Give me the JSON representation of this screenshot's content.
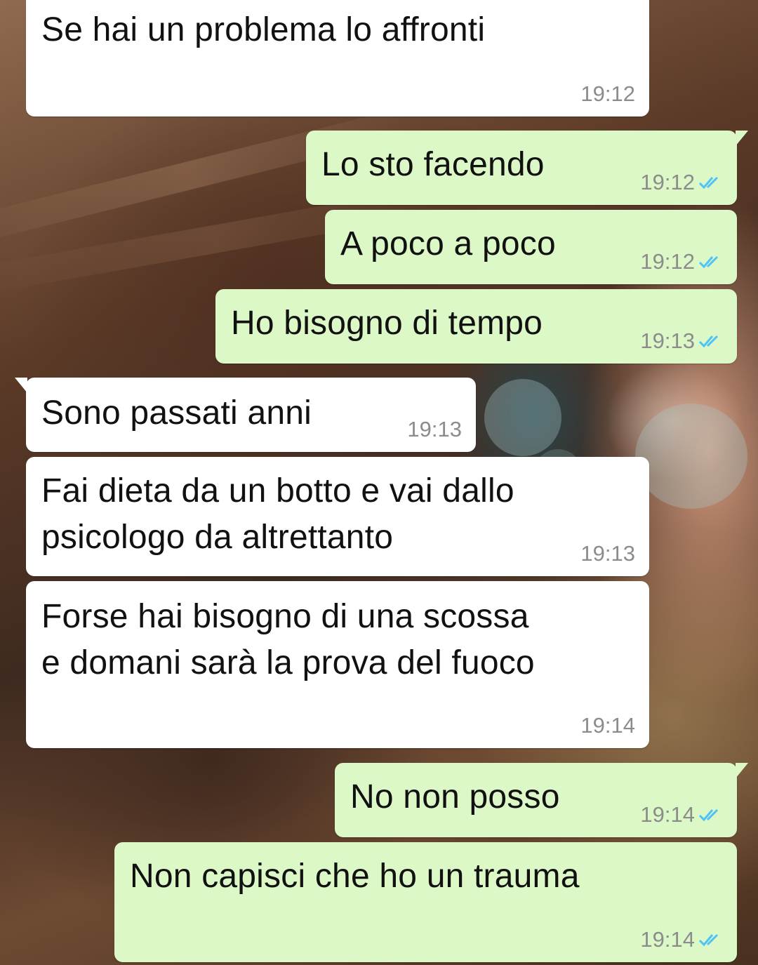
{
  "chat": {
    "messages": [
      {
        "direction": "incoming",
        "text": "Se hai un problema lo affronti",
        "time": "19:12"
      },
      {
        "direction": "outgoing",
        "text": "Lo sto facendo",
        "time": "19:12",
        "status": "read-double-tick-icon"
      },
      {
        "direction": "outgoing",
        "text": "A poco a poco",
        "time": "19:12",
        "status": "read-double-tick-icon"
      },
      {
        "direction": "outgoing",
        "text": "Ho bisogno di tempo",
        "time": "19:13",
        "status": "read-double-tick-icon"
      },
      {
        "direction": "incoming",
        "text": "Sono passati anni",
        "time": "19:13"
      },
      {
        "direction": "incoming",
        "text": "Fai dieta da un botto e vai dallo\npsicologo da altrettanto",
        "time": "19:13"
      },
      {
        "direction": "incoming",
        "text": "Forse hai bisogno di una scossa\ne domani sarà la prova del fuoco",
        "time": "19:14"
      },
      {
        "direction": "outgoing",
        "text": "No non posso",
        "time": "19:14",
        "status": "read-double-tick-icon"
      },
      {
        "direction": "outgoing",
        "text": "Non capisci che ho un trauma",
        "time": "19:14",
        "status": "read-double-tick-icon"
      }
    ]
  },
  "colors": {
    "incoming_bubble": "#ffffff",
    "outgoing_bubble": "#dcf8c6",
    "timestamp": "#8c8c8c",
    "read_ticks": "#4fc3f7"
  }
}
